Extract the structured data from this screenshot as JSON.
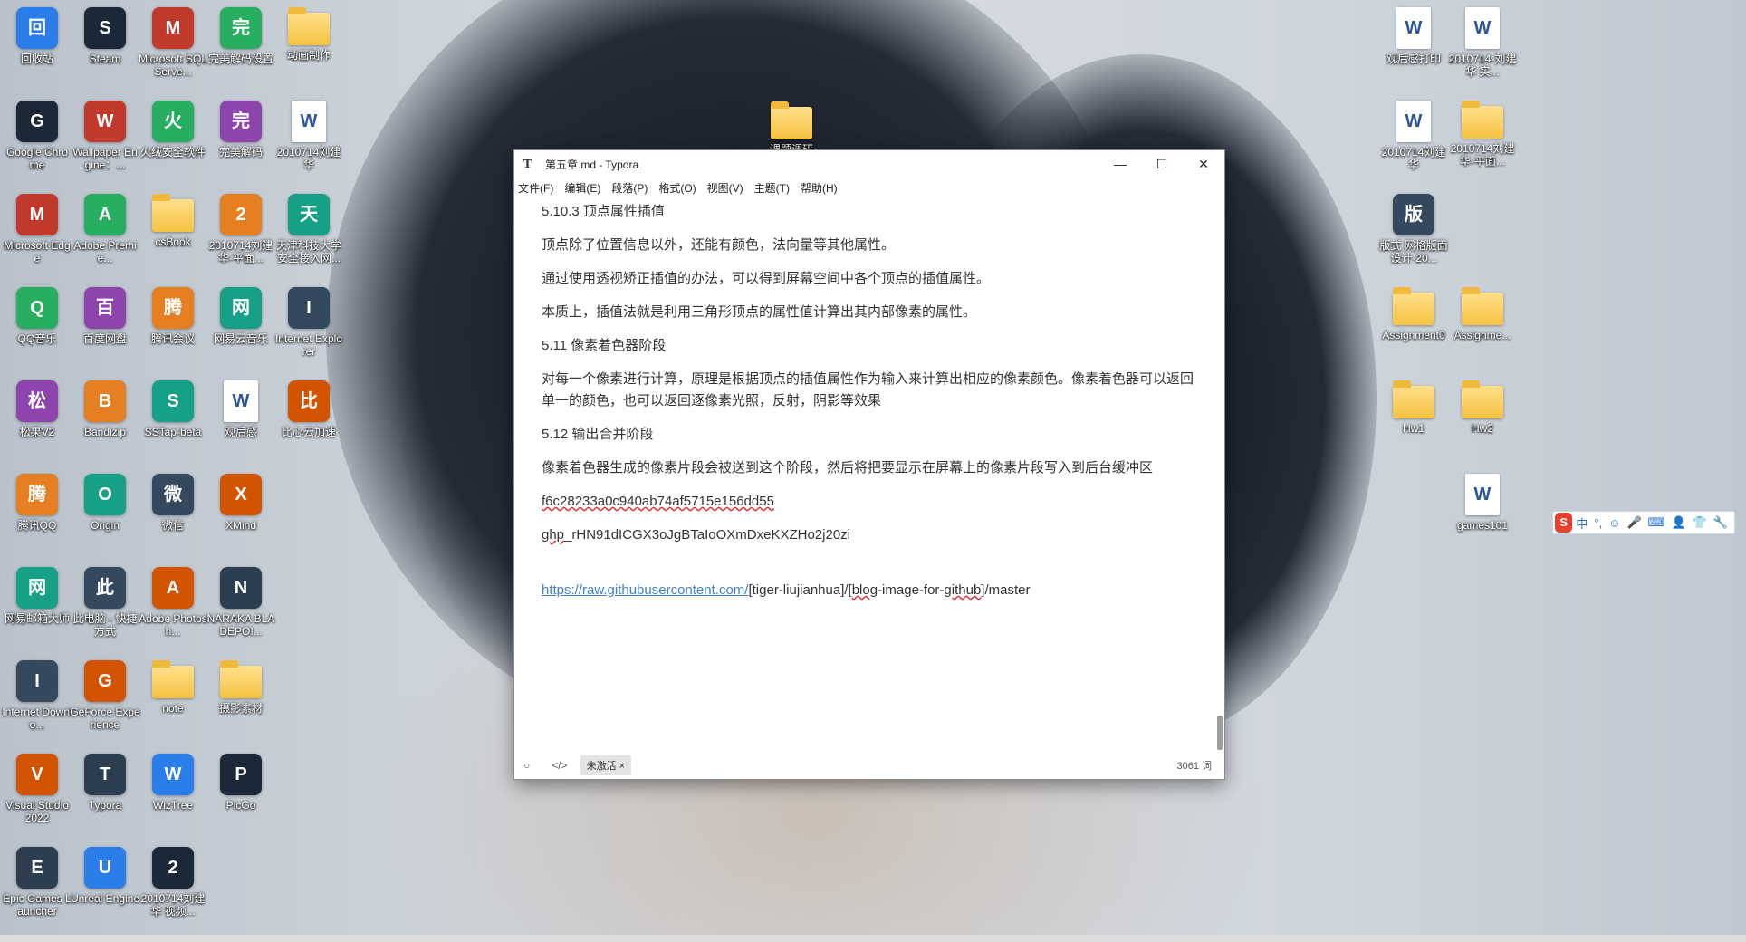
{
  "desktop_icons": {
    "col1": [
      "回收站",
      "Google Chrome",
      "Microsoft Edge",
      "QQ音乐",
      "松果V2",
      "腾讯QQ",
      "网易邮箱大师",
      "Internet Downlo...",
      "Visual Studio 2022",
      "Epic Games Launcher"
    ],
    "col2": [
      "Steam",
      "Wallpaper Engine：...",
      "Adobe Premie...",
      "百度网盘",
      "Bandizip",
      "Origin",
      "此电脑 - 快捷方式",
      "GeForce Experience",
      "Typora",
      "Unreal Engine"
    ],
    "col3": [
      "Microsoft SQL Serve...",
      "火绒安全软件",
      "csBook",
      "腾讯会议",
      "SSTap-beta",
      "微信",
      "Adobe Photosh...",
      "note",
      "WizTree",
      "2010714刘建华 视频..."
    ],
    "col4": [
      "完美解码设置",
      "完美解码",
      "2010714刘建华-平面...",
      "网易云音乐",
      "观后感",
      "XMind",
      "NARAKA BLADEPOI...",
      "摄影素材",
      "PicGo"
    ],
    "col5": [
      "动画制作",
      "2010714刘建华",
      "天津科技大学安全接入网...",
      "Internet Explorer",
      "比心云加速"
    ],
    "mid_folder": "课题调研",
    "right_col1": [
      "观后感打印",
      "2010714刘建华",
      "版式 网格版面设计-20...",
      "Assignment0",
      "Hw1"
    ],
    "right_col2": [
      "2010714-刘建华 实...",
      "2010714刘建华-平面...",
      "Assignme...",
      "Hw2",
      "games101"
    ]
  },
  "window": {
    "app_icon": "T",
    "title": "第五章.md - Typora",
    "controls": {
      "minimize": "—",
      "maximize": "☐",
      "close": "✕"
    },
    "menu": [
      "文件(F)",
      "编辑(E)",
      "段落(P)",
      "格式(O)",
      "视图(V)",
      "主题(T)",
      "帮助(H)"
    ],
    "content": {
      "h1": "5.10.3 顶点属性插值",
      "p1": "顶点除了位置信息以外，还能有颜色，法向量等其他属性。",
      "p2": "通过使用透视矫正插值的办法，可以得到屏幕空间中各个顶点的插值属性。",
      "p3": "本质上，插值法就是利用三角形顶点的属性值计算出其内部像素的属性。",
      "h2": "5.11 像素着色器阶段",
      "p4": "对每一个像素进行计算，原理是根据顶点的插值属性作为输入来计算出相应的像素颜色。像素着色器可以返回单一的颜色，也可以返回逐像素光照，反射，阴影等效果",
      "h3": "5.12 输出合并阶段",
      "p5": "像素着色器生成的像素片段会被送到这个阶段，然后将把要显示在屏幕上的像素片段写入到后台缓冲区",
      "hash": "f6c28233a0c940ab74af5715e156dd55",
      "token_prefix": "ghp",
      "token_rest": "_rHN91dICGX3oJgBTaIoOXmDxeKXZHo2j20zi",
      "url_link": "https://raw.githubusercontent.com/",
      "url_part1": "[tiger-liujianhua]/[",
      "url_blog": "blog",
      "url_part2": "-image-for-",
      "url_github": "github",
      "url_part3": "]/master"
    },
    "status": {
      "outline_icon": "○",
      "source_icon": "</>",
      "tag": "未激活 ×",
      "word_count": "3061 词"
    }
  },
  "ime": {
    "logo": "S",
    "items": [
      "中",
      "°,",
      "☺",
      "🎤",
      "⌨",
      "👤",
      "👕",
      "🔧"
    ]
  }
}
